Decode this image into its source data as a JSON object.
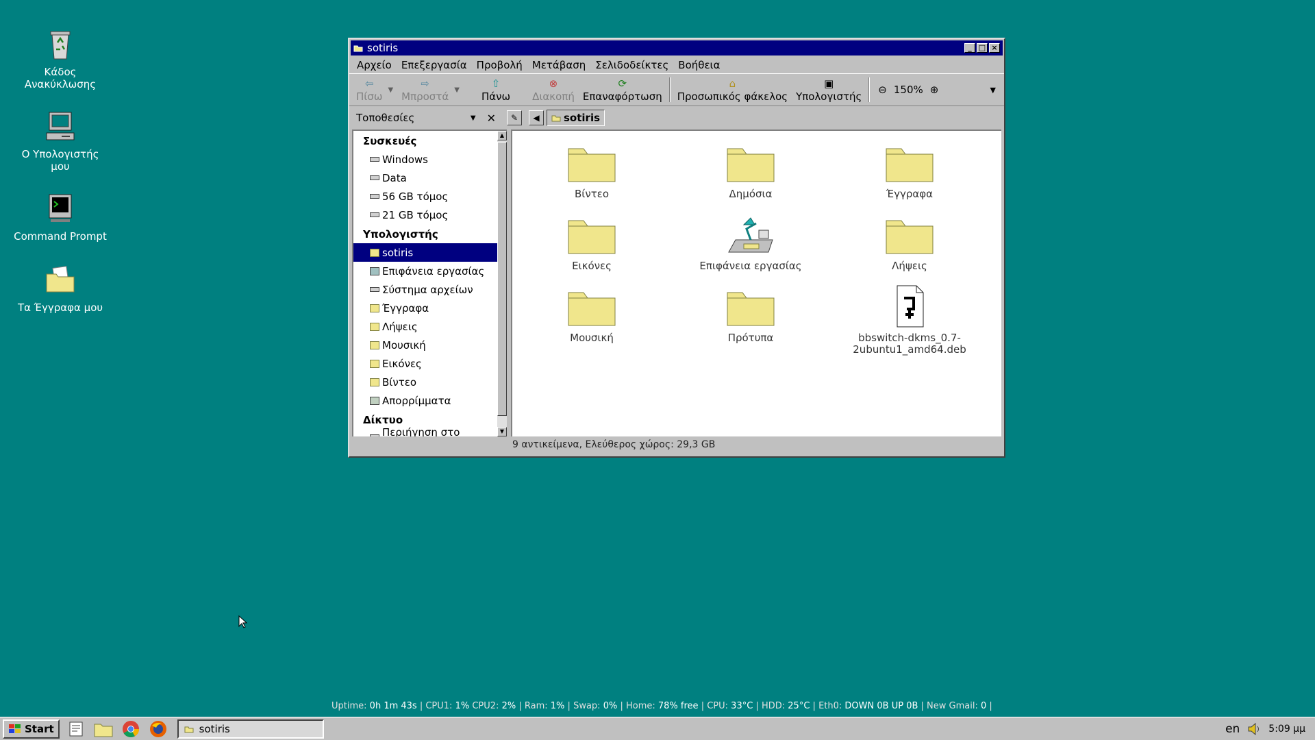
{
  "desktop": {
    "icons": [
      {
        "label_1": "Κάδος",
        "label_2": "Ανακύκλωσης"
      },
      {
        "label_1": "Ο Υπολογιστής",
        "label_2": "μου"
      },
      {
        "label_1": "Command Prompt",
        "label_2": ""
      },
      {
        "label_1": "Τα Έγγραφα μου",
        "label_2": ""
      }
    ]
  },
  "window": {
    "title": "sotiris",
    "menu": [
      "Αρχείο",
      "Επεξεργασία",
      "Προβολή",
      "Μετάβαση",
      "Σελιδοδείκτες",
      "Βοήθεια"
    ],
    "toolbar": {
      "back": "Πίσω",
      "forward": "Μπροστά",
      "up": "Πάνω",
      "stop": "Διακοπή",
      "reload": "Επαναφόρτωση",
      "home": "Προσωπικός φάκελος",
      "computer": "Υπολογιστής",
      "zoom": "150%"
    },
    "sidebar": {
      "header": "Τοποθεσίες",
      "section_devices": "Συσκευές",
      "devices": [
        "Windows",
        "Data",
        "56 GB τόμος",
        "21 GB τόμος"
      ],
      "section_computer": "Υπολογιστής",
      "computer_items": [
        "sotiris",
        "Επιφάνεια εργασίας",
        "Σύστημα αρχείων",
        "Έγγραφα",
        "Λήψεις",
        "Μουσική",
        "Εικόνες",
        "Βίντεο",
        "Απορρίμματα"
      ],
      "section_network": "Δίκτυο",
      "network_items": [
        "Περιήγηση στο δίκτυο"
      ]
    },
    "path": "sotiris",
    "files": [
      {
        "name": "Βίντεο"
      },
      {
        "name": "Δημόσια"
      },
      {
        "name": "Έγγραφα"
      },
      {
        "name": "Εικόνες"
      },
      {
        "name": "Επιφάνεια εργασίας"
      },
      {
        "name": "Λήψεις"
      },
      {
        "name": "Μουσική"
      },
      {
        "name": "Πρότυπα"
      },
      {
        "name_1": "bbswitch-dkms_0.7-",
        "name_2": "2ubuntu1_amd64.deb"
      }
    ],
    "status": "9 αντικείμενα, Ελεύθερος χώρος: 29,3 GB"
  },
  "sysinfo": {
    "uptime_label": "Uptime:",
    "uptime": "0h 1m 43s",
    "cpu1_label": "CPU1:",
    "cpu1": "1%",
    "cpu2_label": "CPU2:",
    "cpu2": "2%",
    "ram_label": "Ram:",
    "ram": "1%",
    "swap_label": "Swap:",
    "swap": "0%",
    "home_label": "Home:",
    "home": "78% free",
    "cpu_label": "CPU:",
    "cpu": "33°C",
    "hdd_label": "HDD:",
    "hdd": "25°C",
    "eth_label": "Eth0:",
    "eth_down": "DOWN 0B",
    "eth_up": "UP 0B",
    "gmail_label": "New Gmail:",
    "gmail": "0"
  },
  "taskbar": {
    "start": "Start",
    "task": "sotiris",
    "lang": "en",
    "clock": "5:09 μμ"
  },
  "colors": {
    "desktop": "#008080",
    "titlebar": "#000080",
    "folder": "#f0e68c"
  }
}
